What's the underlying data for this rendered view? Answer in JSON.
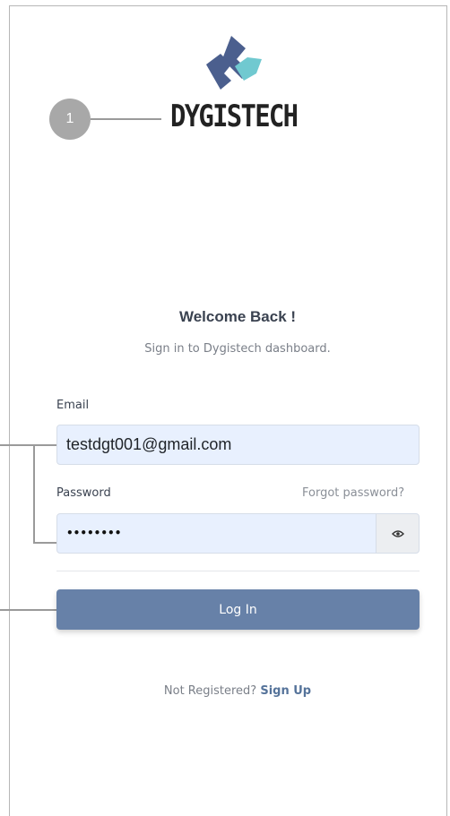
{
  "brand": {
    "name": "DYGISTECH",
    "logo_icon": "dygistech-logo-icon",
    "colors": {
      "dark": "#4b5f8e",
      "accent": "#70c9d0"
    }
  },
  "callout": {
    "number": "1"
  },
  "header": {
    "title": "Welcome Back !",
    "subtitle": "Sign in to Dygistech dashboard."
  },
  "form": {
    "email_label": "Email",
    "email_value": "testdgt001@gmail.com",
    "password_label": "Password",
    "forgot_link": "Forgot password?",
    "password_masked": "••••••••",
    "toggle_icon": "eye-icon",
    "submit_label": "Log In",
    "submit_color": "#6781a8"
  },
  "footer": {
    "prompt": "Not Registered? ",
    "signup_link": "Sign Up"
  }
}
